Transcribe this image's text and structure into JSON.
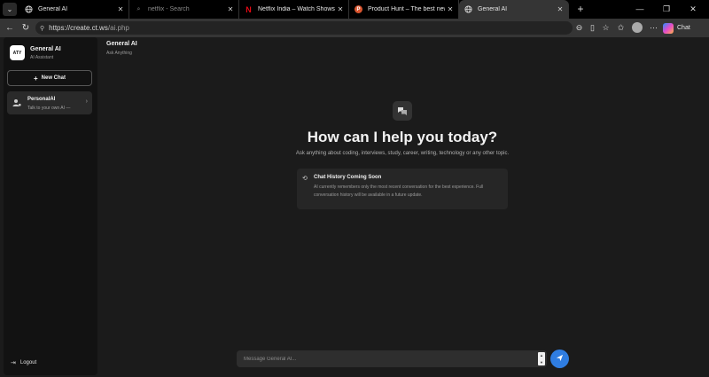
{
  "browser": {
    "tabs": [
      {
        "label": "General AI",
        "icon": "globe-icon",
        "active": false
      },
      {
        "label": "netflix - Search",
        "icon": "search-icon",
        "active": false
      },
      {
        "label": "Netflix India – Watch Shows Online",
        "icon": "netflix-icon",
        "active": false
      },
      {
        "label": "Product Hunt – The best new products",
        "icon": "product-hunt-icon",
        "active": false
      },
      {
        "label": "General AI",
        "icon": "globe-icon",
        "active": true
      }
    ],
    "url_host": "https://create.ct.ws",
    "url_path": "/ai.php",
    "chat_label": "Chat"
  },
  "sidebar": {
    "logo_text": "ATY",
    "app_name": "General AI",
    "app_subtitle": "AI Assistant",
    "new_chat_label": "New Chat",
    "personal": {
      "title": "PersonalAI",
      "subtitle": "Talk to your own AI —"
    },
    "logout_label": "Logout"
  },
  "header": {
    "title": "General AI",
    "subtitle": "Ask Anything"
  },
  "hero": {
    "title": "How can I help you today?",
    "subtitle": "Ask anything about coding, interviews, study, career, writing, technology or any other topic."
  },
  "notice": {
    "title": "Chat History Coming Soon",
    "body": "AI currently remembers only the most recent conversation for the best experience. Full conversation history will be available in a future update."
  },
  "composer": {
    "placeholder": "Message General AI..."
  },
  "colors": {
    "accent": "#2f7de1",
    "background": "#1b1b1b",
    "sidebar": "#121212"
  }
}
